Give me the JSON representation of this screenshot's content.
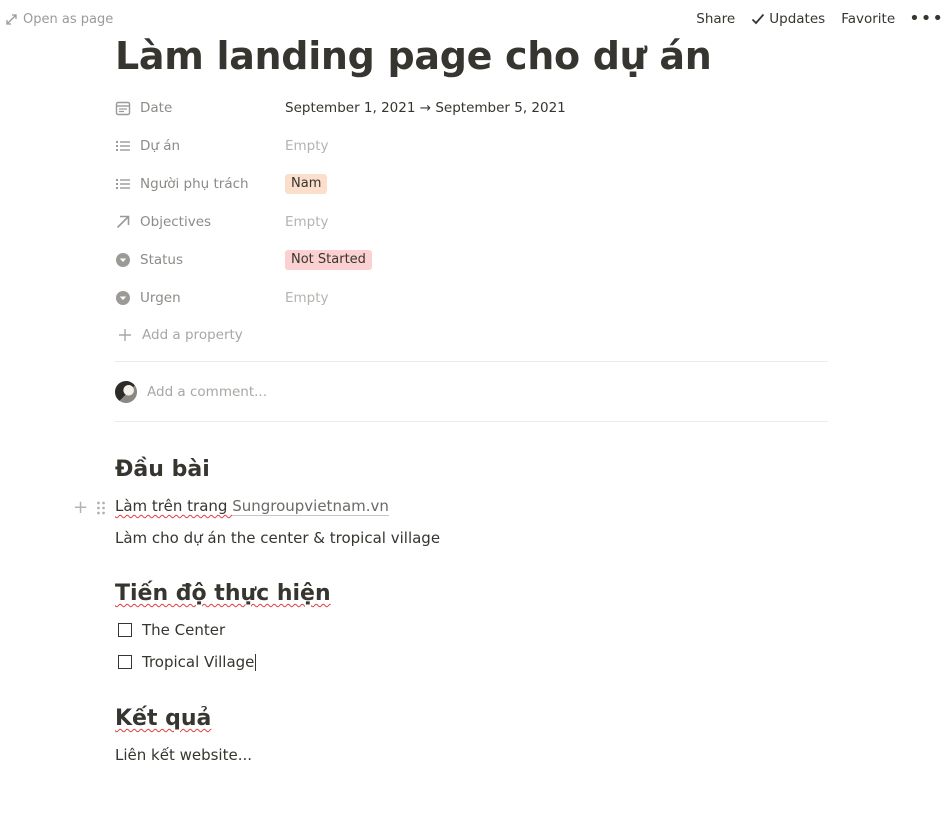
{
  "topbar": {
    "open_as_page": "Open as page",
    "share": "Share",
    "updates": "Updates",
    "favorite": "Favorite",
    "more": "•••"
  },
  "page": {
    "title": "Làm landing page cho dự án"
  },
  "properties": [
    {
      "name": "Date",
      "icon": "calendar-icon",
      "value": "September 1, 2021 → September 5, 2021",
      "empty": false
    },
    {
      "name": "Dự án",
      "icon": "list-icon",
      "value": "Empty",
      "empty": true
    },
    {
      "name": "Người phụ trách",
      "icon": "list-icon",
      "value": "Nam",
      "empty": false,
      "tag_bg": "#fbdfcc"
    },
    {
      "name": "Objectives",
      "icon": "arrow-up-right-icon",
      "value": "Empty",
      "empty": true
    },
    {
      "name": "Status",
      "icon": "select-icon",
      "value": "Not Started",
      "empty": false,
      "tag_bg": "#fbd0d0"
    },
    {
      "name": "Urgen",
      "icon": "select-icon",
      "value": "Empty",
      "empty": true
    }
  ],
  "add_property": "Add a property",
  "comment_placeholder": "Add a comment...",
  "sections": {
    "dau_bai": {
      "heading": "Đầu bài",
      "line1_prefix": "Làm trên trang ",
      "line1_link": "Sungroupvietnam.vn",
      "line2": "Làm cho dự án the center & tropical village"
    },
    "tien_do": {
      "heading": "Tiến độ thực hiện",
      "todos": [
        "The Center",
        "Tropical Village"
      ]
    },
    "ket_qua": {
      "heading": "Kết quả",
      "text": "Liên kết website..."
    }
  },
  "colors": {
    "text": "#37352f",
    "muted": "#9b9a97",
    "tag_orange": "#fbdfcc",
    "tag_red": "#fbd0d0"
  }
}
